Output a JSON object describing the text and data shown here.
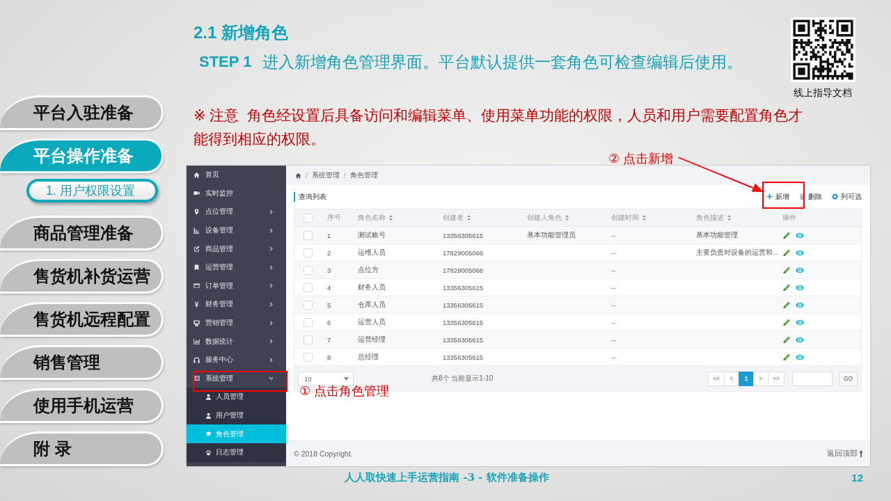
{
  "nav_tabs": [
    {
      "label": "平台入驻准备",
      "selected": false
    },
    {
      "label": "平台操作准备",
      "selected": true,
      "children": [
        {
          "label": "1. 用户权限设置",
          "selected": true
        }
      ]
    },
    {
      "label": "商品管理准备",
      "selected": false
    },
    {
      "label": "售货机补货运营",
      "selected": false
    },
    {
      "label": "售货机远程配置",
      "selected": false
    },
    {
      "label": "销售管理",
      "selected": false
    },
    {
      "label": "使用手机运营",
      "selected": false
    },
    {
      "label": "附 录",
      "selected": false
    }
  ],
  "heading": "2.1 新增角色",
  "step": {
    "label": "STEP 1",
    "text": "进入新增角色管理界面。平台默认提供一套角色可检查编辑后使用。"
  },
  "qr_caption": "线上指导文档",
  "note": "※ 注意  角色经设置后具备访问和编辑菜单、使用菜单功能的权限，人员和用户需要配置角色才能得到相应的权限。",
  "callouts": [
    {
      "kind": "add",
      "text": "② 点击新增"
    },
    {
      "kind": "menu",
      "text": "① 点击角色管理"
    }
  ],
  "app": {
    "sidebar": [
      {
        "kind": "link",
        "label": "首页",
        "selected": false
      },
      {
        "kind": "link",
        "label": "实时监控",
        "selected": false
      },
      {
        "kind": "group",
        "label": "点位管理",
        "selected": false,
        "expanded": false
      },
      {
        "kind": "group",
        "label": "设备管理",
        "selected": false,
        "expanded": false
      },
      {
        "kind": "group",
        "label": "商品管理",
        "selected": false,
        "expanded": false
      },
      {
        "kind": "group",
        "label": "运营管理",
        "selected": false,
        "expanded": false
      },
      {
        "kind": "group",
        "label": "订单管理",
        "selected": false,
        "expanded": false
      },
      {
        "kind": "group",
        "label": "财务管理",
        "selected": false,
        "expanded": false
      },
      {
        "kind": "group",
        "label": "营销管理",
        "selected": false,
        "expanded": false
      },
      {
        "kind": "group",
        "label": "数据统计",
        "selected": false,
        "expanded": false
      },
      {
        "kind": "group",
        "label": "服务中心",
        "selected": false,
        "expanded": false
      },
      {
        "kind": "group",
        "label": "系统管理",
        "selected": false,
        "expanded": true,
        "children": [
          {
            "label": "人员管理",
            "selected": false
          },
          {
            "label": "用户管理",
            "selected": false
          },
          {
            "label": "角色管理",
            "selected": true
          },
          {
            "label": "日志管理",
            "selected": false
          }
        ]
      }
    ],
    "breadcrumb": {
      "separator": "/",
      "items": [
        "系统管理",
        "角色管理"
      ]
    },
    "panel_title": "查询列表",
    "toolbar": [
      "新增",
      "删除",
      "列可选"
    ],
    "table": {
      "columns": [
        {
          "kind": "checkbox",
          "checked": false
        },
        {
          "kind": "text",
          "label": "序号",
          "sortable": false
        },
        {
          "kind": "text",
          "label": "角色名称",
          "sortable": true
        },
        {
          "kind": "text",
          "label": "创建者",
          "sortable": true
        },
        {
          "kind": "text",
          "label": "创建人角色",
          "sortable": true
        },
        {
          "kind": "text",
          "label": "创建时间",
          "sortable": true
        },
        {
          "kind": "text",
          "label": "角色描述",
          "sortable": true
        },
        {
          "kind": "actions",
          "label": "操作",
          "sortable": false
        }
      ],
      "rows": [
        {
          "checked": false,
          "no": "1",
          "name": "测试账号",
          "creator": "13356305615",
          "creator_role": "基本功能管理员",
          "created_at": "--",
          "description": "基本功能管理"
        },
        {
          "checked": false,
          "no": "2",
          "name": "运维人员",
          "creator": "17829005066",
          "created_at": "--",
          "description": "主要负责对设备的运营和..."
        },
        {
          "checked": false,
          "no": "3",
          "name": "点位方",
          "creator": "17829005066",
          "created_at": "--"
        },
        {
          "checked": false,
          "no": "4",
          "name": "财务人员",
          "creator": "13356305615",
          "created_at": "--"
        },
        {
          "checked": false,
          "no": "5",
          "name": "仓库人员",
          "creator": "13356305615",
          "created_at": "--"
        },
        {
          "checked": false,
          "no": "6",
          "name": "运营人员",
          "creator": "13356305615",
          "created_at": "--"
        },
        {
          "checked": false,
          "no": "7",
          "name": "运营经理",
          "creator": "13356305615",
          "created_at": "--"
        },
        {
          "checked": false,
          "no": "8",
          "name": "总经理",
          "creator": "13356305615",
          "created_at": "--"
        }
      ]
    },
    "pagination": {
      "page_size": "10",
      "summary": "共8个 当前显示1-10",
      "pages": [
        {
          "label": "<<",
          "selected": false
        },
        {
          "label": "<",
          "selected": false
        },
        {
          "label": "1",
          "selected": true
        },
        {
          "label": ">",
          "selected": false
        },
        {
          "label": ">>",
          "selected": false
        }
      ],
      "go": "GO"
    },
    "footer": {
      "copyright": "© 2018 Copyright.",
      "back_to_top": "返回顶部"
    }
  },
  "slide_footer": {
    "title": "人人取快速上手运营指南 -3 - 软件准备操作",
    "page": "12"
  }
}
